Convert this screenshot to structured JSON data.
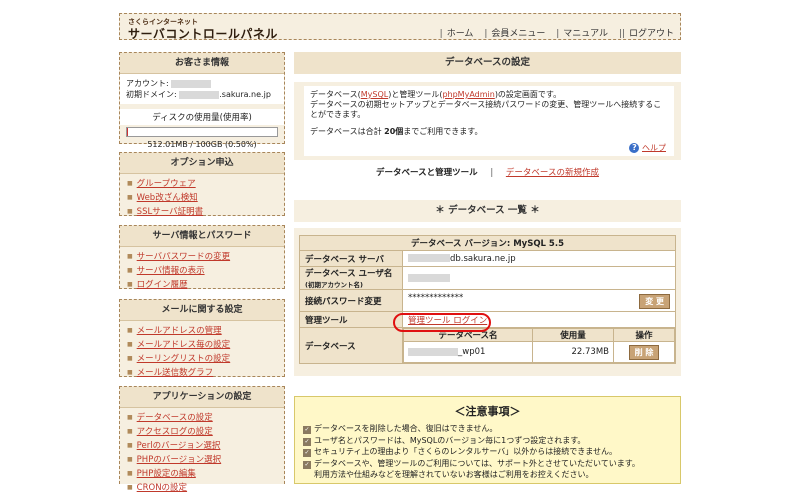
{
  "header": {
    "logo_small": "さくらインターネット",
    "logo_big": "サーバコントロールパネル",
    "nav": [
      "ホーム",
      "会員メニュー",
      "マニュアル",
      "ログアウト"
    ]
  },
  "customer": {
    "title": "お客さま情報",
    "account_label": "アカウント:",
    "domain_label": "初期ドメイン:",
    "domain_suffix": ".sakura.ne.jp",
    "disk_label": "ディスクの使用量(使用率)",
    "disk_value": "512.01MB / 100GB (0.50%)",
    "disk_percent": 0.5
  },
  "options": {
    "title": "オプション申込",
    "items": [
      "グループウェア",
      "Web改ざん検知",
      "SSLサーバ証明書"
    ]
  },
  "server_info": {
    "title": "サーバ情報とパスワード",
    "items": [
      "サーバパスワードの変更",
      "サーバ情報の表示",
      "ログイン履歴"
    ]
  },
  "mail": {
    "title": "メールに関する設定",
    "items": [
      "メールアドレスの管理",
      "メールアドレス毎の設定",
      "メーリングリストの設定",
      "メール送信数グラフ"
    ]
  },
  "apps": {
    "title": "アプリケーションの設定",
    "items": [
      "データベースの設定",
      "アクセスログの設定",
      "Perlのバージョン選択",
      "PHPのバージョン選択",
      "PHP設定の編集",
      "CRONの設定"
    ]
  },
  "main": {
    "title": "データベースの設定",
    "desc_line1_pre": "データベース(",
    "desc_mysql": "MySQL",
    "desc_line1_mid": ")と管理ツール(",
    "desc_pma": "phpMyAdmin",
    "desc_line1_post": ")の設定画面です。",
    "desc_line2": "データベースの初期セットアップとデータベース接続パスワードの変更、管理ツールへ接続することができます。",
    "desc_line3_pre": "データベースは合計 ",
    "desc_count": "20個",
    "desc_line3_post": "までご利用できます。",
    "help": "ヘルプ",
    "tab_current": "データベースと管理ツール",
    "tab_new": "データベースの新規作成",
    "list_title": "＊ データベース 一覧 ＊"
  },
  "db": {
    "caption": "データベース バージョン: MySQL 5.5",
    "server_label": "データベース サーバ",
    "server_value": "db.sakura.ne.jp",
    "user_label": "データベース ユーザ名",
    "user_sub": "(初期アカウント名)",
    "pw_label": "接続パスワード変更",
    "pw_value": "*************",
    "change_btn": "変 更",
    "tool_label": "管理ツール",
    "tool_link": "管理ツール ログイン",
    "db_label": "データベース",
    "col_name": "データベース名",
    "col_usage": "使用量",
    "col_op": "操作",
    "db_name_suffix": "_wp01",
    "db_usage": "22.73MB",
    "delete_btn": "削 除"
  },
  "notes": {
    "title": "＜注意事項＞",
    "items": [
      "データベースを削除した場合、復旧はできません。",
      "ユーザ名とパスワードは、MySQLのバージョン毎に1つずつ設定されます。",
      "セキュリティ上の理由より「さくらのレンタルサーバ」以外からは接続できません。",
      "データベースや、管理ツールのご利用については、サポート外とさせていただいています。",
      "利用方法や仕組みなどを理解されていないお客様はご利用をお控えください。"
    ]
  }
}
